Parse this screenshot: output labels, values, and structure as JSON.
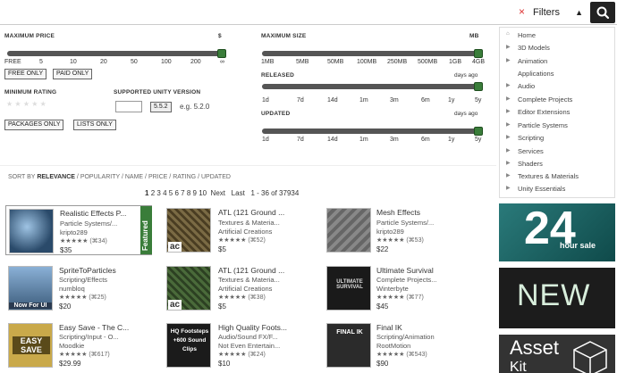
{
  "search": {
    "placeholder": "",
    "clear": "×",
    "filters_label": "Filters",
    "filters_arrow": "▲"
  },
  "filters": {
    "max_price": {
      "label": "MAXIMUM PRICE",
      "unit": "$",
      "ticks": [
        "FREE",
        "5",
        "10",
        "20",
        "50",
        "100",
        "200",
        "∞"
      ],
      "level": 1.0
    },
    "free_only": "FREE ONLY",
    "paid_only": "PAID ONLY",
    "min_rating": {
      "label": "MINIMUM RATING",
      "stars": [
        "★",
        "★",
        "★",
        "★",
        "★"
      ]
    },
    "unity_version": {
      "label": "SUPPORTED UNITY VERSION",
      "value": "",
      "button": "5.5.2",
      "example": "e.g. 5.2.0"
    },
    "packages_only": "PACKAGES ONLY",
    "lists_only": "LISTS ONLY",
    "max_size": {
      "label": "MAXIMUM SIZE",
      "unit": "MB",
      "ticks": [
        "1MB",
        "5MB",
        "50MB",
        "100MB",
        "250MB",
        "500MB",
        "1GB",
        "4GB"
      ],
      "level": 1.0
    },
    "released": {
      "label": "RELEASED",
      "unit": "days ago",
      "ticks": [
        "1d",
        "7d",
        "14d",
        "1m",
        "3m",
        "6m",
        "1y",
        "5y"
      ],
      "level": 1.0
    },
    "updated": {
      "label": "UPDATED",
      "unit": "days ago",
      "ticks": [
        "1d",
        "7d",
        "14d",
        "1m",
        "3m",
        "6m",
        "1y",
        "5y"
      ],
      "level": 1.0
    }
  },
  "categories": [
    {
      "label": "Home",
      "icon": "home-icon"
    },
    {
      "label": "3D Models",
      "icon": "triangle-right-icon"
    },
    {
      "label": "Animation",
      "icon": "triangle-right-icon"
    },
    {
      "label": "Applications",
      "icon": ""
    },
    {
      "label": "Audio",
      "icon": "triangle-right-icon"
    },
    {
      "label": "Complete Projects",
      "icon": "triangle-right-icon"
    },
    {
      "label": "Editor Extensions",
      "icon": "triangle-right-icon"
    },
    {
      "label": "Particle Systems",
      "icon": "triangle-right-icon"
    },
    {
      "label": "Scripting",
      "icon": "triangle-right-icon"
    },
    {
      "label": "Services",
      "icon": "triangle-right-icon"
    },
    {
      "label": "Shaders",
      "icon": "triangle-right-icon"
    },
    {
      "label": "Textures & Materials",
      "icon": "triangle-right-icon"
    },
    {
      "label": "Unity Essentials",
      "icon": "triangle-right-icon"
    }
  ],
  "sort": {
    "prefix": "SORT BY",
    "options": [
      "RELEVANCE",
      "POPULARITY",
      "NAME",
      "PRICE",
      "RATING",
      "UPDATED"
    ],
    "active": "RELEVANCE"
  },
  "pager": {
    "pages": [
      "1",
      "2",
      "3",
      "4",
      "5",
      "6",
      "7",
      "8",
      "9",
      "10"
    ],
    "current": "1",
    "next": "Next",
    "last": "Last",
    "range": "1 - 36 of 37934"
  },
  "products": [
    {
      "title": "Realistic Effects P...",
      "category": "Particle Systems/...",
      "publisher": "kripto289",
      "stars": "★★★★★",
      "reviews": "(⌘34)",
      "price": "$35",
      "featured": "Featured",
      "thumb": "#3b5a7a"
    },
    {
      "title": "ATL (121 Ground ...",
      "category": "Textures & Materia...",
      "publisher": "Artificial Creations",
      "stars": "★★★★★",
      "reviews": "(⌘52)",
      "price": "$5",
      "thumb": "#6b5a3a"
    },
    {
      "title": "Mesh Effects",
      "category": "Particle Systems/...",
      "publisher": "kripto289",
      "stars": "★★★★★",
      "reviews": "(⌘53)",
      "price": "$22",
      "thumb": "#777"
    },
    {
      "title": "SpriteToParticles",
      "category": "Scripting/Effects",
      "publisher": "numbloq",
      "stars": "★★★★★",
      "reviews": "(⌘25)",
      "price": "$20",
      "thumb": "#4a6a8a",
      "thumb_text": "Now For UI"
    },
    {
      "title": "ATL (121 Ground ...",
      "category": "Textures & Materia...",
      "publisher": "Artificial Creations",
      "stars": "★★★★★",
      "reviews": "(⌘38)",
      "price": "$5",
      "thumb": "#3e5a34"
    },
    {
      "title": "Ultimate Survival",
      "category": "Complete Projects...",
      "publisher": "Winterbyte",
      "stars": "★★★★★",
      "reviews": "(⌘77)",
      "price": "$45",
      "thumb": "#222",
      "thumb_text": "ULTIMATE SURVIVAL"
    },
    {
      "title": "Easy Save - The C...",
      "category": "Scripting/Input - O...",
      "publisher": "Moodkie",
      "stars": "★★★★★",
      "reviews": "(⌘617)",
      "price": "$29.99",
      "thumb": "#d8c070",
      "thumb_text": "EASY SAVE"
    },
    {
      "title": "High Quality Foots...",
      "category": "Audio/Sound FX/F...",
      "publisher": "Not Even Entertain...",
      "stars": "★★★★★",
      "reviews": "(⌘24)",
      "price": "$10",
      "thumb": "#222",
      "thumb_text": "HQ Footsteps +600 Sound Clips"
    },
    {
      "title": "Final IK",
      "category": "Scripting/Animation",
      "publisher": "RootMotion",
      "stars": "★★★★★",
      "reviews": "(⌘543)",
      "price": "$90",
      "thumb": "#333",
      "thumb_text": "FINAL IK"
    }
  ],
  "ads": [
    {
      "big": "24",
      "small": "hour sale",
      "bg": "#1f6b6b"
    },
    {
      "big": "NEW",
      "bg": "#1c1c1c"
    },
    {
      "big": "Asset",
      "small": "Kit",
      "bg": "#333"
    }
  ],
  "colors": {
    "slider_track": "#555",
    "slider_knob": "#3a7d3a",
    "featured": "#3a7d3a"
  }
}
